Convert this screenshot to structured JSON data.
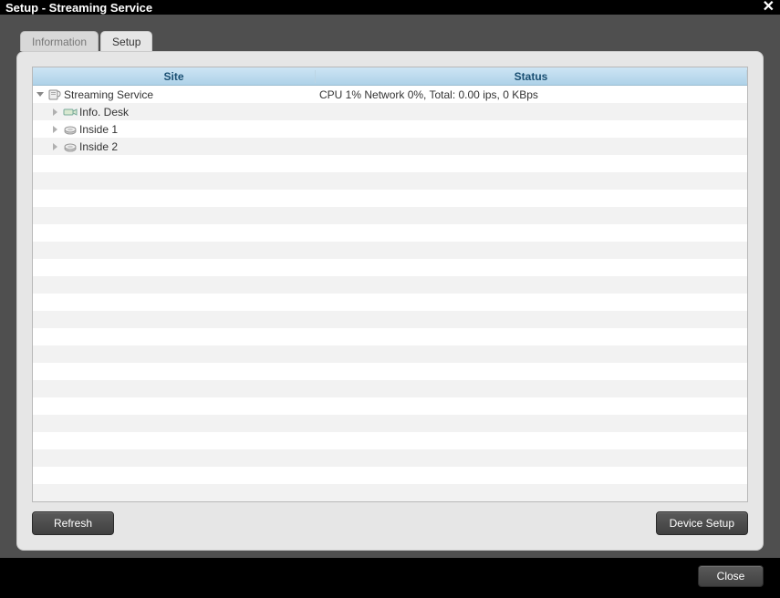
{
  "window": {
    "title": "Setup - Streaming Service"
  },
  "tabs": {
    "information": "Information",
    "setup": "Setup"
  },
  "table": {
    "headers": {
      "site": "Site",
      "status": "Status"
    },
    "rows": [
      {
        "indent": 0,
        "expanded": true,
        "icon": "server",
        "site": "Streaming Service",
        "status": "CPU 1% Network 0%, Total: 0.00 ips, 0 KBps"
      },
      {
        "indent": 1,
        "expanded": false,
        "icon": "camera",
        "site": "Info. Desk",
        "status": ""
      },
      {
        "indent": 1,
        "expanded": false,
        "icon": "device",
        "site": "Inside 1",
        "status": ""
      },
      {
        "indent": 1,
        "expanded": false,
        "icon": "device",
        "site": "Inside 2",
        "status": ""
      }
    ]
  },
  "buttons": {
    "refresh": "Refresh",
    "device_setup": "Device Setup",
    "close": "Close"
  }
}
